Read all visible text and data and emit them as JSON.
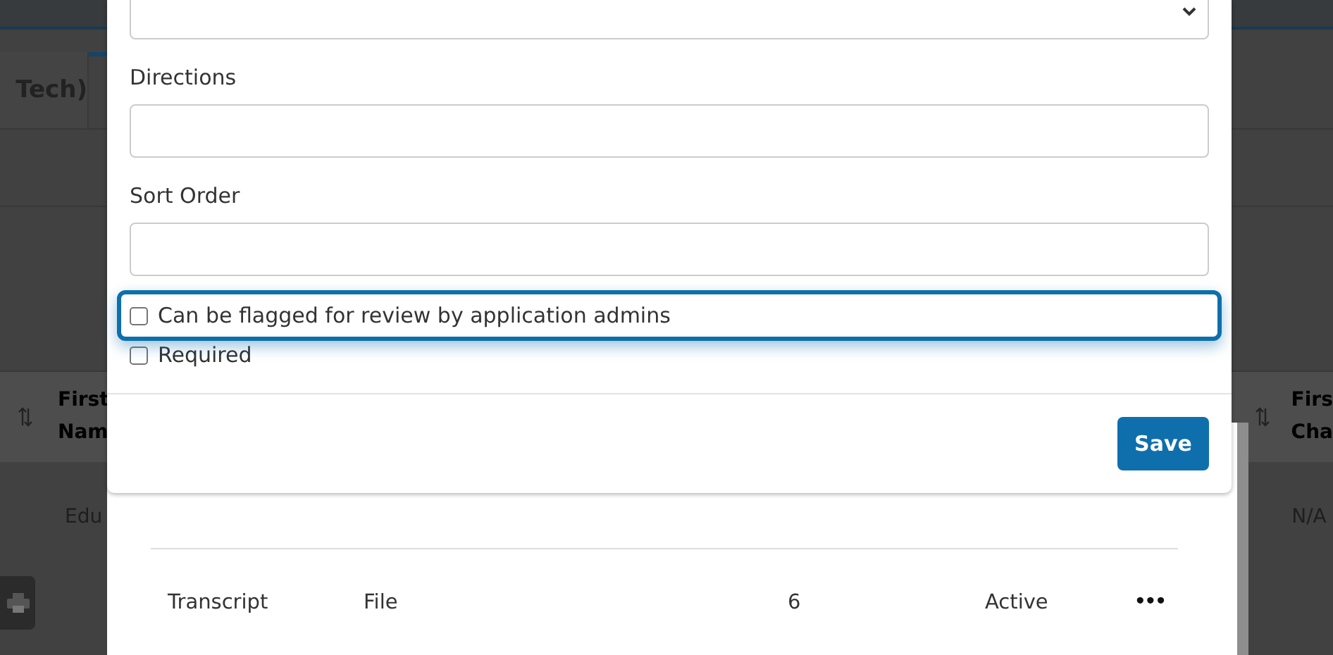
{
  "background_page": {
    "tab": "Tech)",
    "left_header": [
      "First",
      "Nam"
    ],
    "right_header": [
      "Firs",
      "Cha"
    ],
    "left_cell": "Edu",
    "right_cell": "N/A"
  },
  "list_panel": {
    "rows": [
      {
        "name": "Transcript",
        "type": "File",
        "order": "6",
        "status": "Active",
        "menu": "•••"
      }
    ]
  },
  "dialog": {
    "fields": [
      {
        "label": "Directions"
      },
      {
        "label": "Sort Order"
      }
    ],
    "checkboxes": [
      {
        "label": "Can be flagged for review by application admins",
        "checked": false,
        "focused": true
      },
      {
        "label": "Required",
        "checked": false,
        "focused": false
      }
    ],
    "save_button": "Save"
  }
}
